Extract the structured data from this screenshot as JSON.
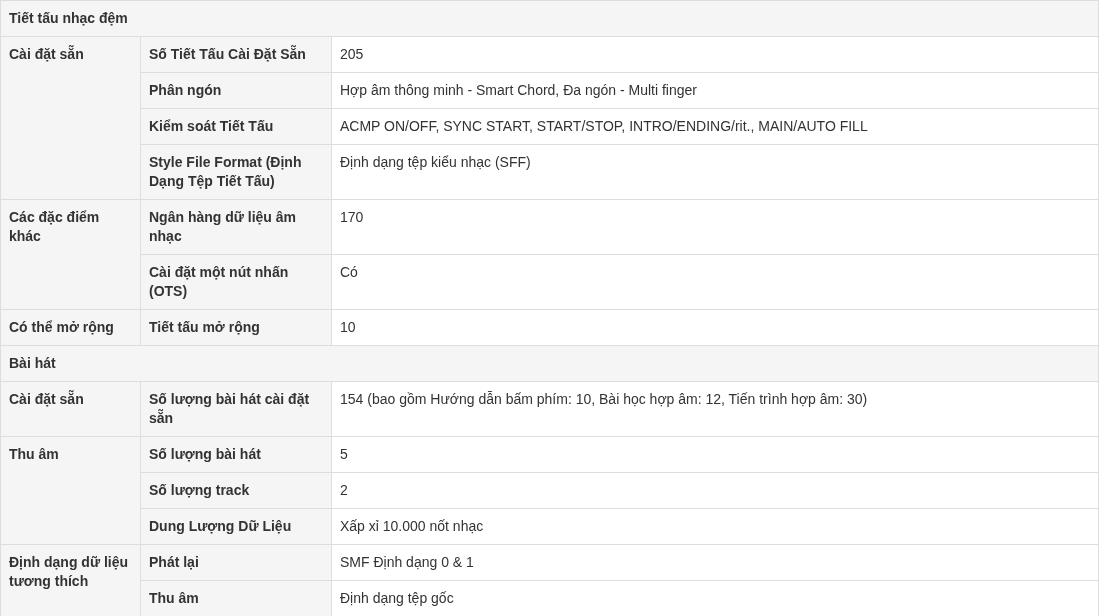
{
  "sections": [
    {
      "title": "Tiết tấu nhạc đệm",
      "groups": [
        {
          "label": "Cài đặt sẵn",
          "rows": [
            {
              "label": "Số Tiết Tấu Cài Đặt Sẵn",
              "value": "205"
            },
            {
              "label": "Phân ngón",
              "value": "Hợp âm thông minh - Smart Chord, Đa ngón - Multi finger"
            },
            {
              "label": "Kiểm soát Tiết Tấu",
              "value": "ACMP ON/OFF, SYNC START, START/STOP, INTRO/ENDING/rit., MAIN/AUTO FILL"
            },
            {
              "label": "Style File Format (Định Dạng Tệp Tiết Tấu)",
              "value": "Định dạng tệp kiểu nhạc (SFF)"
            }
          ]
        },
        {
          "label": "Các đặc điểm khác",
          "rows": [
            {
              "label": "Ngân hàng dữ liệu âm nhạc",
              "value": "170"
            },
            {
              "label": "Cài đặt một nút nhấn (OTS)",
              "value": "Có"
            }
          ]
        },
        {
          "label": "Có thể mở rộng",
          "rows": [
            {
              "label": "Tiết tấu mở rộng",
              "value": "10"
            }
          ]
        }
      ]
    },
    {
      "title": "Bài hát",
      "groups": [
        {
          "label": "Cài đặt sẵn",
          "rows": [
            {
              "label": "Số lượng bài hát cài đặt sẵn",
              "value": "154 (bao gồm Hướng dẫn bấm phím: 10, Bài học hợp âm: 12, Tiến trình hợp âm: 30)"
            }
          ]
        },
        {
          "label": "Thu âm",
          "rows": [
            {
              "label": "Số lượng bài hát",
              "value": "5"
            },
            {
              "label": "Số lượng track",
              "value": "2"
            },
            {
              "label": "Dung Lượng Dữ Liệu",
              "value": "Xấp xỉ 10.000 nốt nhạc"
            }
          ]
        },
        {
          "label": "Định dạng dữ liệu tương thích",
          "rows": [
            {
              "label": "Phát lại",
              "value": "SMF Định dạng 0 & 1"
            },
            {
              "label": "Thu âm",
              "value": "Định dạng tệp gốc"
            }
          ]
        }
      ]
    }
  ]
}
